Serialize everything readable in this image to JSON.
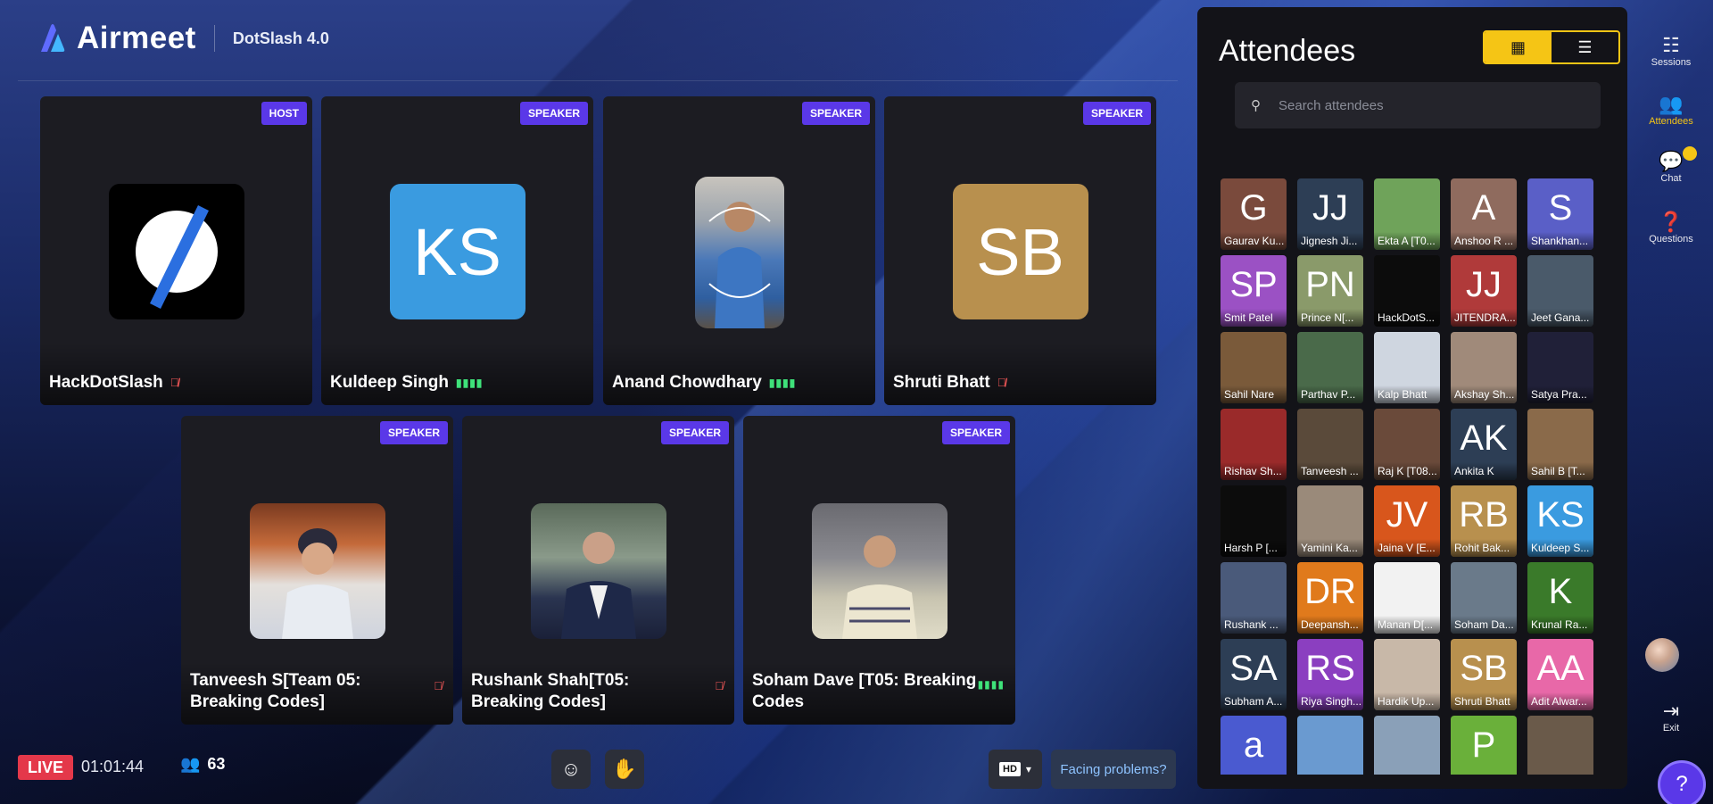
{
  "header": {
    "brand": "Airmeet",
    "event_name": "DotSlash 4.0"
  },
  "tiles": [
    {
      "badge": "HOST",
      "name": "HackDotSlash",
      "mic": "off"
    },
    {
      "badge": "SPEAKER",
      "name": "Kuldeep Singh",
      "mic": "on",
      "initials": "KS",
      "color": "#3a9be0"
    },
    {
      "badge": "SPEAKER",
      "name": "Anand Chowdhary",
      "mic": "on"
    },
    {
      "badge": "SPEAKER",
      "name": "Shruti Bhatt",
      "mic": "off",
      "initials": "SB",
      "color": "#b8904e"
    },
    {
      "badge": "SPEAKER",
      "name": "Tanveesh S[Team 05: Breaking Codes]",
      "mic": "off"
    },
    {
      "badge": "SPEAKER",
      "name": "Rushank Shah[T05: Breaking Codes]",
      "mic": "off"
    },
    {
      "badge": "SPEAKER",
      "name": "Soham Dave [T05: Breaking Codes",
      "mic": "on"
    }
  ],
  "bottom": {
    "live": "LIVE",
    "timer": "01:01:44",
    "participants": "63",
    "hd": "HD",
    "problems": "Facing problems?"
  },
  "attendees": {
    "title": "Attendees",
    "search_placeholder": "Search attendees",
    "list": [
      {
        "name": "Gaurav Ku...",
        "ini": "G",
        "color": "#7a4a3c"
      },
      {
        "name": "Jignesh Ji...",
        "ini": "JJ",
        "color": "#2d3e55"
      },
      {
        "name": "Ekta A [T0...",
        "ini": "",
        "color": "#6fa35a"
      },
      {
        "name": "Anshoo R ...",
        "ini": "A",
        "color": "#8f6b5e"
      },
      {
        "name": "Shankhan...",
        "ini": "S",
        "color": "#5a5fc7"
      },
      {
        "name": "Smit Patel",
        "ini": "SP",
        "color": "#9b51c4"
      },
      {
        "name": "Prince N[...",
        "ini": "PN",
        "color": "#8a9a6a"
      },
      {
        "name": "HackDotS...",
        "ini": "",
        "color": "#0c0c0c"
      },
      {
        "name": "JITENDRA...",
        "ini": "JJ",
        "color": "#b03a3a"
      },
      {
        "name": "Jeet Gana...",
        "ini": "",
        "color": "#4a5a6a"
      },
      {
        "name": "Sahil Nare",
        "ini": "",
        "color": "#7a5a3a"
      },
      {
        "name": "Parthav P...",
        "ini": "",
        "color": "#4a6a4a"
      },
      {
        "name": "Kalp Bhatt",
        "ini": "",
        "color": "#cfd6e0"
      },
      {
        "name": "Akshay Sh...",
        "ini": "",
        "color": "#a08a7a"
      },
      {
        "name": "Satya Pra...",
        "ini": "",
        "color": "#202038"
      },
      {
        "name": "Rishav Sh...",
        "ini": "",
        "color": "#9a2a2a"
      },
      {
        "name": "Tanveesh ...",
        "ini": "",
        "color": "#5a4a3a"
      },
      {
        "name": "Raj K [T08...",
        "ini": "",
        "color": "#6a4a3a"
      },
      {
        "name": "Ankita K",
        "ini": "AK",
        "color": "#2d3e55"
      },
      {
        "name": "Sahil B [T...",
        "ini": "",
        "color": "#8a6a4a"
      },
      {
        "name": "Harsh P [...",
        "ini": "",
        "color": "#0c0c0c"
      },
      {
        "name": "Yamini Ka...",
        "ini": "",
        "color": "#9a8a7a"
      },
      {
        "name": "Jaina V [E...",
        "ini": "JV",
        "color": "#d8561c"
      },
      {
        "name": "Rohit Bak...",
        "ini": "RB",
        "color": "#b8904e"
      },
      {
        "name": "Kuldeep S...",
        "ini": "KS",
        "color": "#3a9be0"
      },
      {
        "name": "Rushank ...",
        "ini": "",
        "color": "#4a5a7a"
      },
      {
        "name": "Deepansh...",
        "ini": "DR",
        "color": "#e07a1c"
      },
      {
        "name": "Manan D[...",
        "ini": "",
        "color": "#f2f2f2"
      },
      {
        "name": "Soham Da...",
        "ini": "",
        "color": "#6a7a8a"
      },
      {
        "name": "Krunal Ra...",
        "ini": "K",
        "color": "#3a7a2a"
      },
      {
        "name": "Subham A...",
        "ini": "SA",
        "color": "#2d3e55"
      },
      {
        "name": "Riya Singh...",
        "ini": "RS",
        "color": "#8b3fc0"
      },
      {
        "name": "Hardik Up...",
        "ini": "",
        "color": "#c8b8a8"
      },
      {
        "name": "Shruti Bhatt",
        "ini": "SB",
        "color": "#b8904e"
      },
      {
        "name": "Adit Alwar...",
        "ini": "AA",
        "color": "#e868a8"
      },
      {
        "name": "",
        "ini": "a",
        "color": "#4a5ad0"
      },
      {
        "name": "",
        "ini": "",
        "color": "#6a9ad0"
      },
      {
        "name": "",
        "ini": "",
        "color": "#8aa0b8"
      },
      {
        "name": "",
        "ini": "P",
        "color": "#6ab03a"
      },
      {
        "name": "",
        "ini": "",
        "color": "#6a5a4a"
      }
    ]
  },
  "rail": {
    "sessions": "Sessions",
    "attendees": "Attendees",
    "chat": "Chat",
    "questions": "Questions",
    "exit": "Exit"
  }
}
